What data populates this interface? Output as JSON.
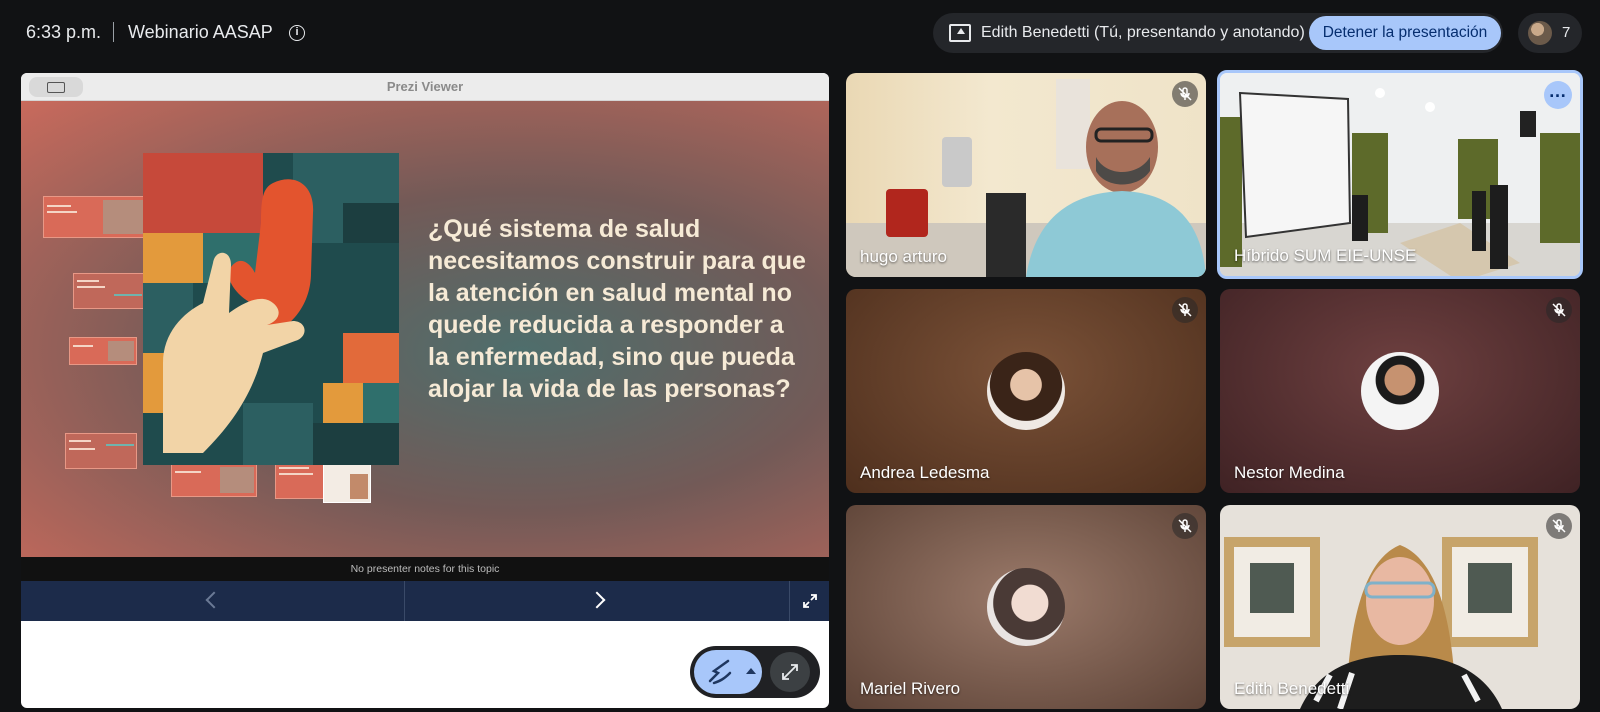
{
  "topbar": {
    "time": "6:33 p.m.",
    "meeting_title": "Webinario AASAP",
    "presenting_status": "Edith Benedetti (Tú, presentando y anotando)",
    "stop_presenting_label": "Detener la presentación",
    "participant_count": "7"
  },
  "prezi": {
    "window_title": "Prezi Viewer",
    "slide_question": "¿Qué sistema de salud necesitamos construir para que la atención en salud mental no quede reducida a responder a la enfermedad, sino que pueda alojar la vida de las personas?",
    "presenter_notes": "No presenter notes for this topic"
  },
  "participants": [
    {
      "name": "hugo arturo",
      "muted": true
    },
    {
      "name": "Híbrido SUM EIE-UNSE",
      "muted": false
    },
    {
      "name": "Andrea Ledesma",
      "muted": true
    },
    {
      "name": "Nestor Medina",
      "muted": true
    },
    {
      "name": "Mariel Rivero",
      "muted": true
    },
    {
      "name": "Edith Benedetti",
      "muted": true
    }
  ],
  "colors": {
    "accent": "#a8c7fa",
    "background": "#111214",
    "slide_text": "#f6ead6"
  }
}
